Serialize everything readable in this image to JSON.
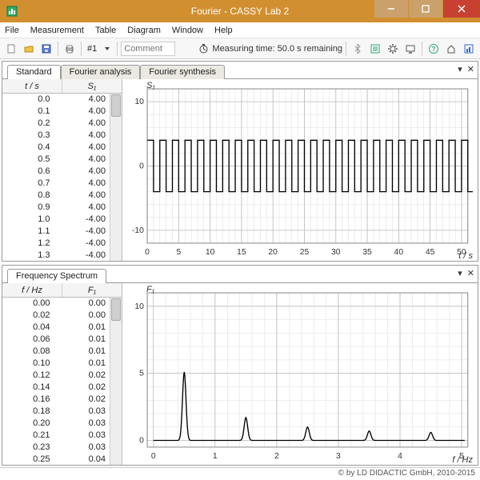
{
  "window": {
    "title": "Fourier - CASSY Lab 2"
  },
  "menu": [
    "File",
    "Measurement",
    "Table",
    "Diagram",
    "Window",
    "Help"
  ],
  "toolbar": {
    "pager_label": "#1",
    "comment_placeholder": "Comment",
    "status_prefix": "Measuring time:",
    "status_value": "50.0 s remaining"
  },
  "tabs_top": {
    "items": [
      "Standard",
      "Fourier analysis",
      "Fourier synthesis"
    ],
    "active": 0
  },
  "tabs_bottom": {
    "items": [
      "Frequency Spectrum"
    ],
    "active": 0
  },
  "table_top": {
    "headers": [
      "t / s",
      "S₁"
    ],
    "rows": [
      [
        "0.0",
        "4.00"
      ],
      [
        "0.1",
        "4.00"
      ],
      [
        "0.2",
        "4.00"
      ],
      [
        "0.3",
        "4.00"
      ],
      [
        "0.4",
        "4.00"
      ],
      [
        "0.5",
        "4.00"
      ],
      [
        "0.6",
        "4.00"
      ],
      [
        "0.7",
        "4.00"
      ],
      [
        "0.8",
        "4.00"
      ],
      [
        "0.9",
        "4.00"
      ],
      [
        "1.0",
        "-4.00"
      ],
      [
        "1.1",
        "-4.00"
      ],
      [
        "1.2",
        "-4.00"
      ],
      [
        "1.3",
        "-4.00"
      ]
    ]
  },
  "table_bottom": {
    "headers": [
      "f / Hz",
      "F₁"
    ],
    "rows": [
      [
        "0.00",
        "0.00"
      ],
      [
        "0.02",
        "0.00"
      ],
      [
        "0.04",
        "0.01"
      ],
      [
        "0.06",
        "0.01"
      ],
      [
        "0.08",
        "0.01"
      ],
      [
        "0.10",
        "0.01"
      ],
      [
        "0.12",
        "0.02"
      ],
      [
        "0.14",
        "0.02"
      ],
      [
        "0.16",
        "0.02"
      ],
      [
        "0.18",
        "0.03"
      ],
      [
        "0.20",
        "0.03"
      ],
      [
        "0.21",
        "0.03"
      ],
      [
        "0.23",
        "0.03"
      ],
      [
        "0.25",
        "0.04"
      ]
    ]
  },
  "chart_top": {
    "ylabel": "S₁",
    "xlabel": "t / s",
    "y_ticks": [
      -10,
      0,
      10
    ],
    "x_ticks": [
      0,
      5,
      10,
      15,
      20,
      25,
      30,
      35,
      40,
      45,
      50
    ],
    "ylim": [
      -12,
      12
    ],
    "xlim": [
      0,
      51
    ]
  },
  "chart_bottom": {
    "ylabel": "F₁",
    "xlabel": "f / Hz",
    "y_ticks": [
      0,
      5,
      10
    ],
    "x_ticks": [
      0,
      1,
      2,
      3,
      4,
      5
    ],
    "ylim": [
      -0.5,
      11
    ],
    "xlim": [
      -0.1,
      5.1
    ]
  },
  "chart_data": [
    {
      "type": "line",
      "title": "",
      "xlabel": "t / s",
      "ylabel": "S1",
      "xlim": [
        0,
        51
      ],
      "ylim": [
        -12,
        12
      ],
      "note": "Square wave, amplitude 4, period 2 s",
      "series": [
        {
          "name": "S1",
          "period": 2.0,
          "amplitude": 4.0,
          "shape": "square",
          "x_range": [
            0,
            51
          ]
        }
      ]
    },
    {
      "type": "line",
      "title": "",
      "xlabel": "f / Hz",
      "ylabel": "F1",
      "xlim": [
        -0.1,
        5.1
      ],
      "ylim": [
        -0.5,
        11
      ],
      "note": "Frequency spectrum peaks at odd harmonics of 0.5 Hz",
      "series": [
        {
          "name": "F1",
          "peaks": [
            {
              "f": 0.5,
              "F": 5.1
            },
            {
              "f": 1.5,
              "F": 1.7
            },
            {
              "f": 2.5,
              "F": 1.0
            },
            {
              "f": 3.5,
              "F": 0.7
            },
            {
              "f": 4.5,
              "F": 0.6
            }
          ]
        }
      ]
    }
  ],
  "footer": "© by LD DIDACTIC GmbH, 2010-2015"
}
